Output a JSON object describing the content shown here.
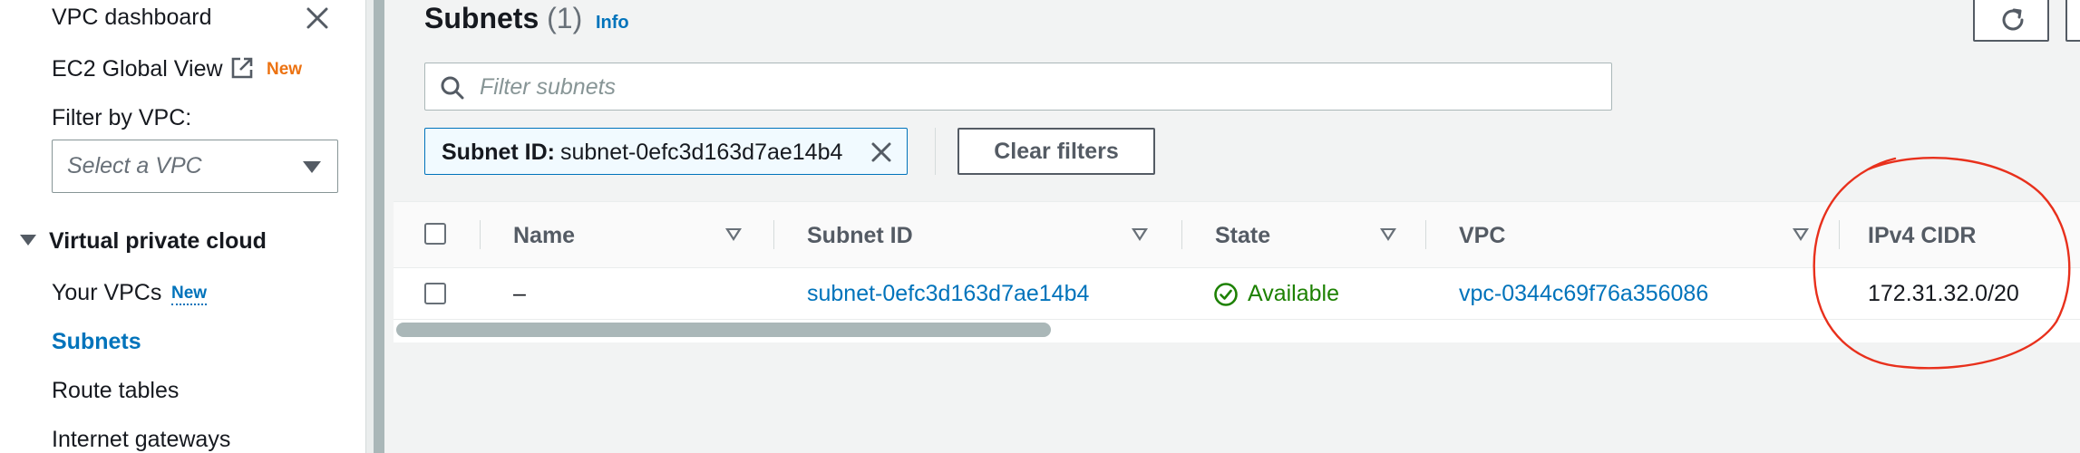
{
  "sidebar": {
    "vpc_dashboard": "VPC dashboard",
    "ec2_global_view": "EC2 Global View",
    "ec2_global_view_badge": "New",
    "filter_by_vpc_label": "Filter by VPC:",
    "filter_by_vpc_placeholder": "Select a VPC",
    "section_title": "Virtual private cloud",
    "items": [
      {
        "label": "Your VPCs",
        "badge": "New"
      },
      {
        "label": "Subnets",
        "active": true
      },
      {
        "label": "Route tables"
      },
      {
        "label": "Internet gateways"
      }
    ]
  },
  "header": {
    "title": "Subnets",
    "count": "(1)",
    "info_link": "Info"
  },
  "search": {
    "placeholder": "Filter subnets",
    "value": ""
  },
  "filter_token": {
    "key": "Subnet ID:",
    "value": "subnet-0efc3d163d7ae14b4"
  },
  "clear_filters_label": "Clear filters",
  "table": {
    "columns": [
      "Name",
      "Subnet ID",
      "State",
      "VPC",
      "IPv4 CIDR"
    ],
    "rows": [
      {
        "name": "–",
        "subnet_id": "subnet-0efc3d163d7ae14b4",
        "state": "Available",
        "vpc": "vpc-0344c69f76a356086",
        "ipv4_cidr": "172.31.32.0/20"
      }
    ]
  },
  "colors": {
    "link": "#0073bb",
    "available": "#1d8102",
    "new_orange": "#ec7211",
    "annotation": "#e8301c"
  },
  "icons": {
    "close": "close-icon",
    "external_link": "external-link-icon",
    "search": "search-icon",
    "refresh": "refresh-icon",
    "status": "check-circle-icon",
    "sort": "sort-down-icon"
  }
}
